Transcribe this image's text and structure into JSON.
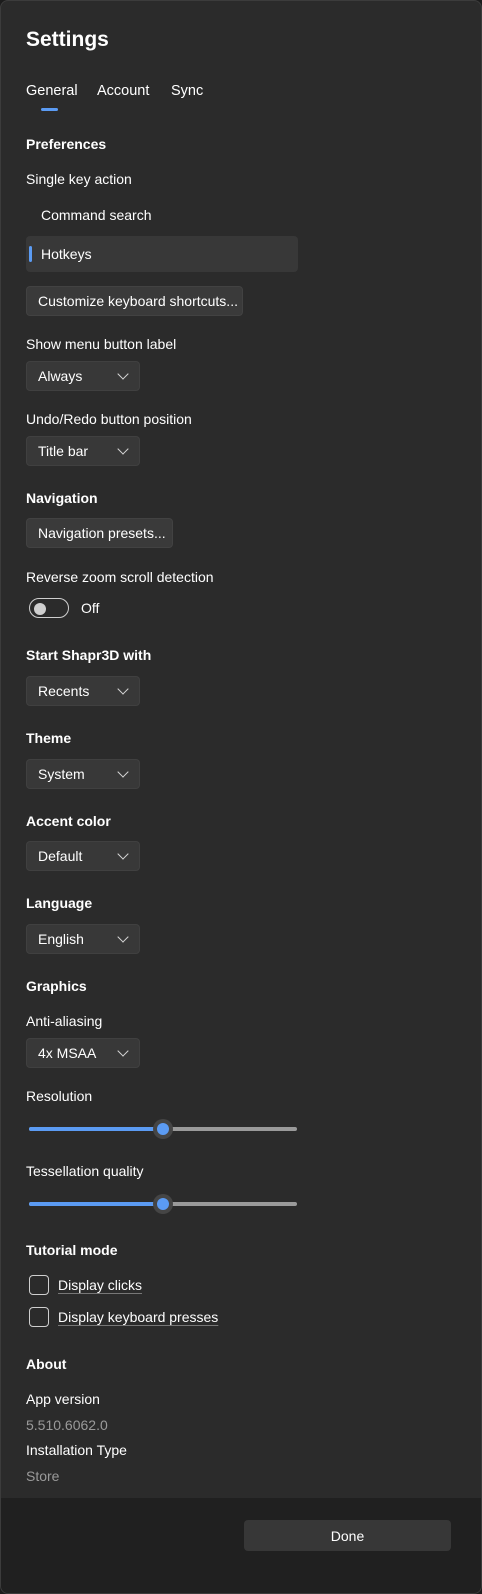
{
  "window": {
    "title": "Settings"
  },
  "tabs": [
    {
      "label": "General",
      "selected": true
    },
    {
      "label": "Account",
      "selected": false
    },
    {
      "label": "Sync",
      "selected": false
    }
  ],
  "preferences": {
    "heading": "Preferences",
    "single_key_label": "Single key action",
    "single_key_options": [
      {
        "label": "Command search",
        "selected": false
      },
      {
        "label": "Hotkeys",
        "selected": true
      }
    ],
    "customize_shortcuts_button": "Customize keyboard shortcuts...",
    "menu_label_label": "Show menu button label",
    "menu_label_value": "Always",
    "undo_redo_label": "Undo/Redo button position",
    "undo_redo_value": "Title bar"
  },
  "navigation": {
    "heading": "Navigation",
    "presets_button": "Navigation presets...",
    "reverse_zoom_label": "Reverse zoom scroll detection",
    "reverse_zoom_state": "Off"
  },
  "start_with": {
    "heading": "Start Shapr3D with",
    "value": "Recents"
  },
  "theme": {
    "heading": "Theme",
    "value": "System"
  },
  "accent": {
    "heading": "Accent color",
    "value": "Default"
  },
  "language": {
    "heading": "Language",
    "value": "English"
  },
  "graphics": {
    "heading": "Graphics",
    "anti_aliasing_label": "Anti-aliasing",
    "anti_aliasing_value": "4x MSAA",
    "resolution_label": "Resolution",
    "resolution_level": 0.5,
    "tessellation_label": "Tessellation quality",
    "tessellation_level": 0.5
  },
  "tutorial": {
    "heading": "Tutorial mode",
    "display_clicks": {
      "label": "Display clicks",
      "checked": false
    },
    "display_keys": {
      "label": "Display keyboard presses",
      "checked": false
    }
  },
  "about": {
    "heading": "About",
    "app_version_label": "App version",
    "app_version_value": "5.510.6062.0",
    "install_type_label": "Installation Type",
    "install_type_value": "Store"
  },
  "footer": {
    "done_label": "Done"
  },
  "colors": {
    "accent": "#5b9bf3",
    "background": "#2b2b2b",
    "footer": "#202020",
    "control": "#383838"
  },
  "icons": {
    "dropdown": "chevron-down-icon"
  }
}
